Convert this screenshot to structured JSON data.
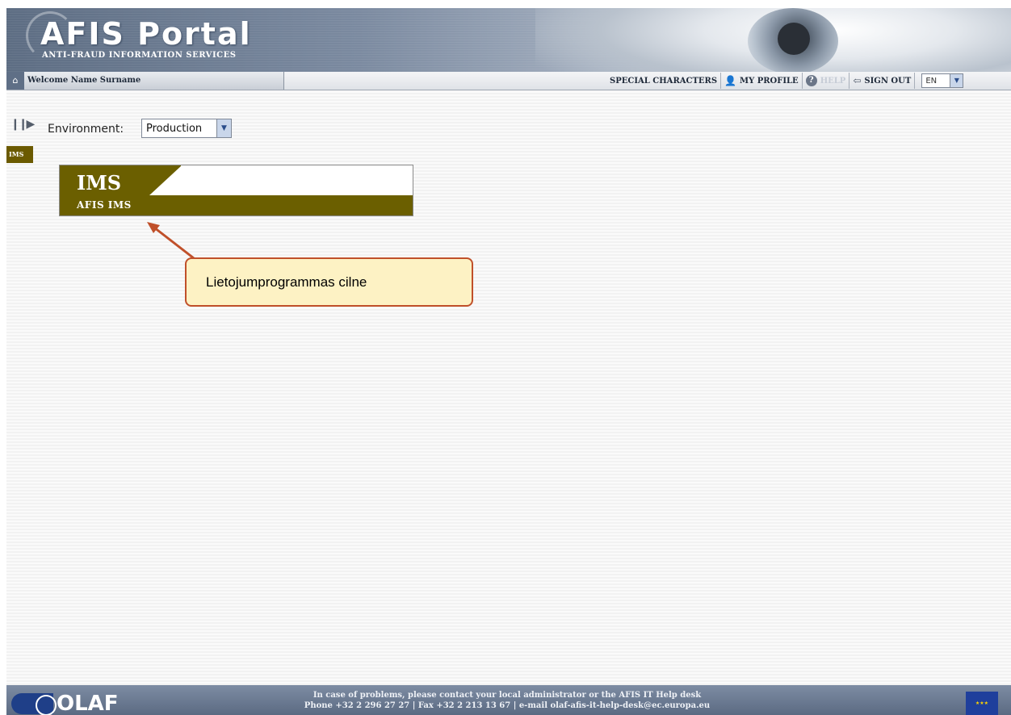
{
  "header": {
    "title": "AFIS Portal",
    "subtitle": "ANTI-FRAUD INFORMATION SERVICES"
  },
  "topbar": {
    "welcome": "Welcome Name Surname",
    "special_characters": "SPECIAL CHARACTERS",
    "my_profile": "MY PROFILE",
    "help": "HELP",
    "sign_out": "SIGN OUT",
    "language": "EN"
  },
  "main": {
    "environment_label": "Environment:",
    "environment_value": "Production",
    "side_tab": "IMS",
    "tile": {
      "title": "IMS",
      "subtitle": "AFIS IMS"
    },
    "callout": "Lietojumprogrammas cilne"
  },
  "footer": {
    "logo": "OLAF",
    "line1": "In case of problems, please contact your local administrator or the AFIS IT Help desk",
    "line2": "Phone +32 2 296 27 27 | Fax +32 2 213 13 67 | e-mail olaf-afis-it-help-desk@ec.europa.eu"
  },
  "colors": {
    "tile": "#6b5f00",
    "callout_border": "#c0502a",
    "callout_fill": "#fdf2c4",
    "header_blue": "#5f6f86"
  },
  "icons": {
    "home": "home-icon",
    "profile": "user-icon",
    "help": "help-icon",
    "sign_out": "sign-out-icon",
    "toggle": "panel-toggle-icon"
  }
}
